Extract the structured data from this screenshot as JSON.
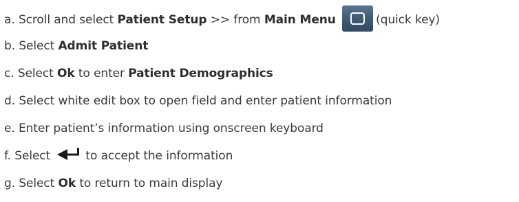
{
  "steps": [
    {
      "marker": "a.",
      "parts": [
        "Scroll and select ",
        "Patient Setup",
        " >> from ",
        "Main Menu",
        "(quick key)"
      ],
      "icon": "monitor-menu-icon"
    },
    {
      "marker": "b.",
      "parts": [
        "Select ",
        "Admit Patient"
      ]
    },
    {
      "marker": "c.",
      "parts": [
        "Select ",
        "Ok",
        " to enter ",
        "Patient Demographics"
      ]
    },
    {
      "marker": "d.",
      "parts": [
        "Select white edit box to open field and enter patient information"
      ]
    },
    {
      "marker": "e.",
      "parts": [
        "Enter patient’s information using onscreen keyboard"
      ]
    },
    {
      "marker": "f.",
      "parts": [
        "Select ",
        "to accept the information"
      ],
      "icon": "enter-arrow-icon"
    },
    {
      "marker": "g.",
      "parts": [
        "Select ",
        "Ok",
        " to return to main display"
      ]
    }
  ],
  "colors": {
    "text": "#3a3a3a",
    "key_background": "#3f5a73",
    "key_glyph": "#ffffff",
    "enter_icon": "#1a1a1a"
  }
}
